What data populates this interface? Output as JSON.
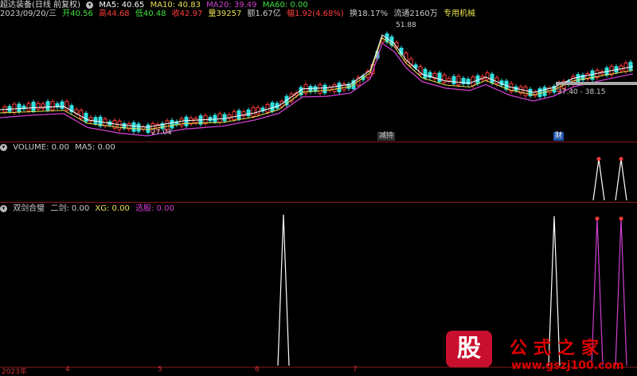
{
  "main_header": {
    "title": "超达装备(日线 前复权)",
    "ma5": "MA5: 40.65",
    "ma10": "MA10: 40.83",
    "ma20": "MA20: 39.49",
    "ma60": "MA60: 0.00",
    "date": "2023/09/20/三",
    "open": "开40.56",
    "high": "高44.68",
    "low": "低40.48",
    "close": "收42.97",
    "volume": "量39257",
    "amount": "额1.67亿",
    "change": "幅1.92(4.68%)",
    "turnover": "换18.17%",
    "float": "流通2160万",
    "tag": "专用机械"
  },
  "price_labels": {
    "high": "51.88",
    "low": "27.04",
    "range": "37.40 - 38.15"
  },
  "badges": {
    "b1": "减持",
    "b2": "财"
  },
  "volume_header": {
    "name": "VOLUME: 0.00",
    "ma5": "MA5: 0.00"
  },
  "indicator_header": {
    "name": "双剑合璧",
    "erjian": "二剑: 0.00",
    "xg": "XG: 0.00",
    "xuangu": "选股: 0.00"
  },
  "x_axis": [
    "2023年",
    "4",
    "5",
    "6",
    "7"
  ],
  "watermark": {
    "logo": "股",
    "title": "公式之家",
    "url": "www.gszj100.com"
  },
  "colors": {
    "up": "#ff3b3b",
    "down": "#33e0e0",
    "ma5": "#ffffff",
    "ma10": "#e8e050",
    "ma20": "#d040d0"
  }
}
